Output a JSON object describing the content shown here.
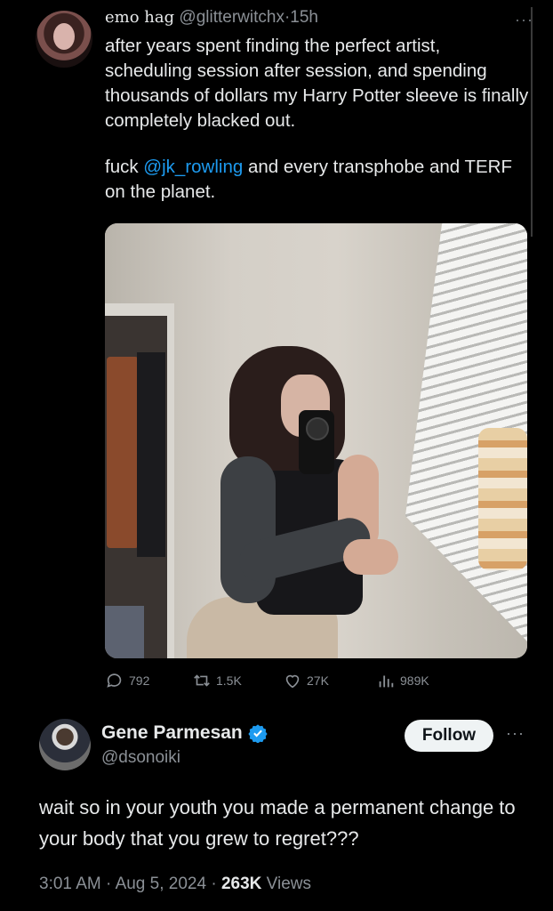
{
  "tweet": {
    "display_name": "emo hag",
    "handle": "@glitterwitchx",
    "separator": "·",
    "time": "15h",
    "more": "···",
    "text_p1": "after years spent finding the perfect artist, scheduling session after session, and spending thousands of dollars my Harry Potter sleeve is finally completely blacked out.",
    "text_p2_before": "fuck ",
    "mention": "@jk_rowling",
    "text_p2_after": " and every transphobe and TERF on the planet.",
    "stats": {
      "replies": "792",
      "retweets": "1.5K",
      "likes": "27K",
      "views": "989K"
    }
  },
  "reply": {
    "display_name": "Gene Parmesan",
    "handle": "@dsonoiki",
    "follow_label": "Follow",
    "more": "···",
    "text": "wait so in your youth you made a permanent change to your body that you grew to regret???",
    "time": "3:01 AM",
    "date": "Aug 5, 2024",
    "sep": "·",
    "views_count": "263K",
    "views_label": "Views"
  },
  "icons": [
    "reply-icon",
    "retweet-icon",
    "like-icon",
    "views-icon",
    "verified-badge-icon",
    "more-icon"
  ],
  "colors": {
    "background": "#000000",
    "text": "#e7e9ea",
    "muted": "#8b9096",
    "link": "#1d9bf0",
    "verified": "#1d9bf0"
  }
}
